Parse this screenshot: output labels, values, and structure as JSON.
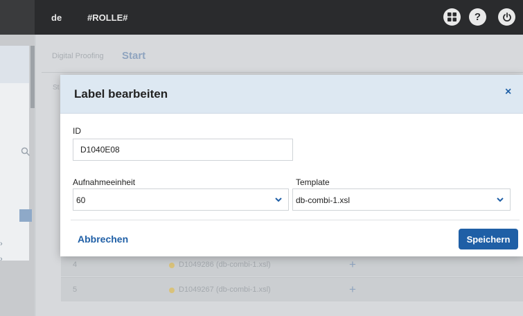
{
  "header": {
    "language": "de",
    "role": "#ROLLE#",
    "help_glyph": "?"
  },
  "breadcrumb": {
    "parent": "Digital Proofing",
    "current": "Start"
  },
  "content": {
    "section_label": "St",
    "rows": [
      {
        "num": "4",
        "label": "D1049286 (db-combi-1.xsl)"
      },
      {
        "num": "5",
        "label": "D1049267 (db-combi-1.xsl)"
      }
    ],
    "add_glyph": "+"
  },
  "left_panel": {
    "chevron": "›"
  },
  "modal": {
    "title": "Label bearbeiten",
    "close_glyph": "×",
    "id_label": "ID",
    "id_value": "D1040E08",
    "unit_label": "Aufnahmeeinheit",
    "unit_value": "60",
    "template_label": "Template",
    "template_value": "db-combi-1.xsl",
    "cancel_label": "Abbrechen",
    "save_label": "Speichern"
  },
  "colors": {
    "accent": "#1f5fa6",
    "header_bg": "#2a2b2d",
    "modal_head_bg": "#dde8f2"
  },
  "icons": {
    "apps": "grid-icon",
    "help": "help-icon",
    "power": "power-icon",
    "search": "search-icon",
    "select": "chevron-down-icon"
  }
}
